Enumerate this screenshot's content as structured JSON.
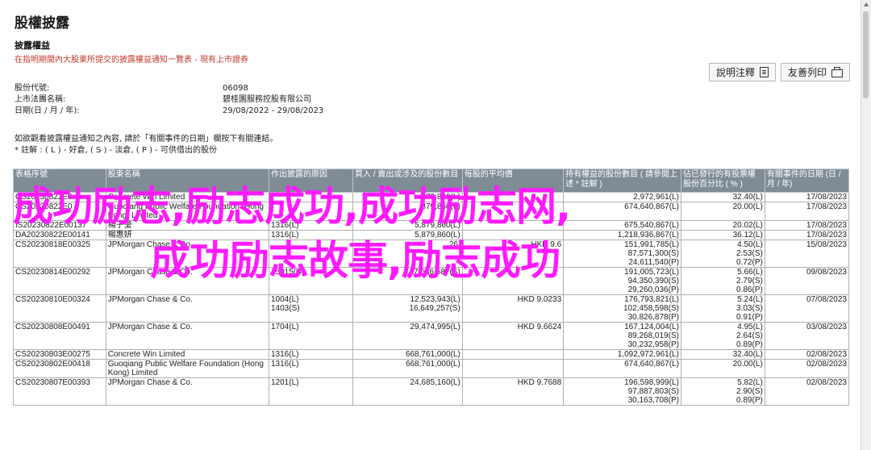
{
  "page": {
    "title": "股權披露",
    "section_title": "披露權益",
    "subtitle": "在指明期間內大股東所提交的披露權益通知一覽表 - 現有上市證券"
  },
  "buttons": {
    "notes_label": "說明注釋",
    "print_label": "友善列印"
  },
  "info": {
    "stock_code_label": "股份代號:",
    "stock_code_value": "06098",
    "company_label": "上市法團名稱:",
    "company_value": "碧桂園服務控股有限公司",
    "date_label": "日期(日 / 月 / 年):",
    "date_value": "29/08/2022 - 29/08/2023"
  },
  "note": {
    "line1": "如欲觀看披露權益通知之內容, 請於「有關事件的日期」欄按下有關連結。",
    "line2": "* 註解 : ( L ) - 好倉, ( S ) - 淡倉, ( P ) - 可供借出的股份"
  },
  "table": {
    "headers": [
      "表格序號",
      "股東名稱",
      "作出披露的原因",
      "買入 / 賣出或涉及的股份數目",
      "每股的平均價",
      "持有權益的股份數目 ( 請參閱上述 * 註解 )",
      "佔已發行的有投票權股份百分比 ( % )",
      "有關事件的日期 (日 / 月 / 年)"
    ],
    "rows": [
      {
        "form": "CS20230822E0",
        "name": "Concrete Win Limited",
        "reason": "",
        "shares": "879,860(L)",
        "price": "",
        "interest": "2,972,961(L)",
        "pct": "32.40(L)",
        "date": "17/08/2023"
      },
      {
        "form": "CS20230822E0",
        "name": "Guoqiang Public Welfare Foundation (Hong Kong) Limited",
        "reason": "",
        "shares": "879,860(L)",
        "price": "",
        "interest": "674,640,867(L)",
        "pct": "20.00(L)",
        "date": "17/08/2023"
      },
      {
        "form": "IS20230822E00137",
        "name": "楊子瑩",
        "reason": "1316(L)",
        "shares": "5,879,860(L)",
        "price": "",
        "interest": "675,540,867(L)",
        "pct": "20.02(L)",
        "date": "17/08/2023"
      },
      {
        "form": "DA20230822E00141",
        "name": "楊惠妍",
        "reason": "1316(L)",
        "shares": "5,879,860(L)",
        "price": "",
        "interest": "1,218,936,867(L)",
        "pct": "36.12(L)",
        "date": "17/08/2023"
      },
      {
        "form": "CS20230818E00325",
        "name": "JPMorgan Chase & Co.",
        "reason": "",
        "shares": "26,",
        "price": "HKD 9.6",
        "interest": "151,991,785(L)\n87,571,300(S)\n24,611,540(P)",
        "pct": "4.50(L)\n2.53(S)\n0.72(P)",
        "date": "15/08/2023"
      },
      {
        "form": "CS20230814E00292",
        "name": "JPMorgan Chase & Co.",
        "reason": "15015(S)",
        "shares": "7,636,587(S)",
        "price": "",
        "interest": "191,005,723(L)\n94,350,390(S)\n29,260,036(P)",
        "pct": "5.66(L)\n2.79(S)\n0.86(P)",
        "date": "09/08/2023"
      },
      {
        "form": "CS20230810E00324",
        "name": "JPMorgan Chase & Co.",
        "reason": "1004(L)\n1403(S)",
        "shares": "12,523,943(L)\n16,649,257(S)",
        "price": "HKD 9.0233",
        "interest": "176,793,821(L)\n102,458,598(S)\n30,826,878(P)",
        "pct": "5.24(L)\n3.03(S)\n0.91(P)",
        "date": "07/08/2023"
      },
      {
        "form": "CS20230808E00491",
        "name": "JPMorgan Chase & Co.",
        "reason": "1704(L)",
        "shares": "29,474,995(L)",
        "price": "HKD 9.6624",
        "interest": "167,124,004(L)\n89,268,019(S)\n30,232,958(P)",
        "pct": "4.95(L)\n2.64(S)\n0.89(P)",
        "date": "03/08/2023"
      },
      {
        "form": "CS20230803E00275",
        "name": "Concrete Win Limited",
        "reason": "1316(L)",
        "shares": "668,761,000(L)",
        "price": "",
        "interest": "1,092,972,961(L)",
        "pct": "32.40(L)",
        "date": "02/08/2023"
      },
      {
        "form": "CS20230802E00418",
        "name": "Guoqiang Public Welfare Foundation (Hong Kong) Limited",
        "reason": "1316(L)",
        "shares": "668,761,000(L)",
        "price": "",
        "interest": "674,640,867(L)",
        "pct": "20.00(L)",
        "date": "02/08/2023"
      },
      {
        "form": "CS20230807E00393",
        "name": "JPMorgan Chase & Co.",
        "reason": "1201(L)",
        "shares": "24,685,160(L)",
        "price": "HKD 9.7688",
        "interest": "196,598,999(L)\n97,887,803(S)\n30,163,708(P)",
        "pct": "5.82(L)\n2.90(S)\n0.89(P)",
        "date": "02/08/2023"
      }
    ]
  },
  "overlay": {
    "line1": "成功励志,励志成功,成功励志网,",
    "line2": "成功励志故事,励志成功"
  }
}
